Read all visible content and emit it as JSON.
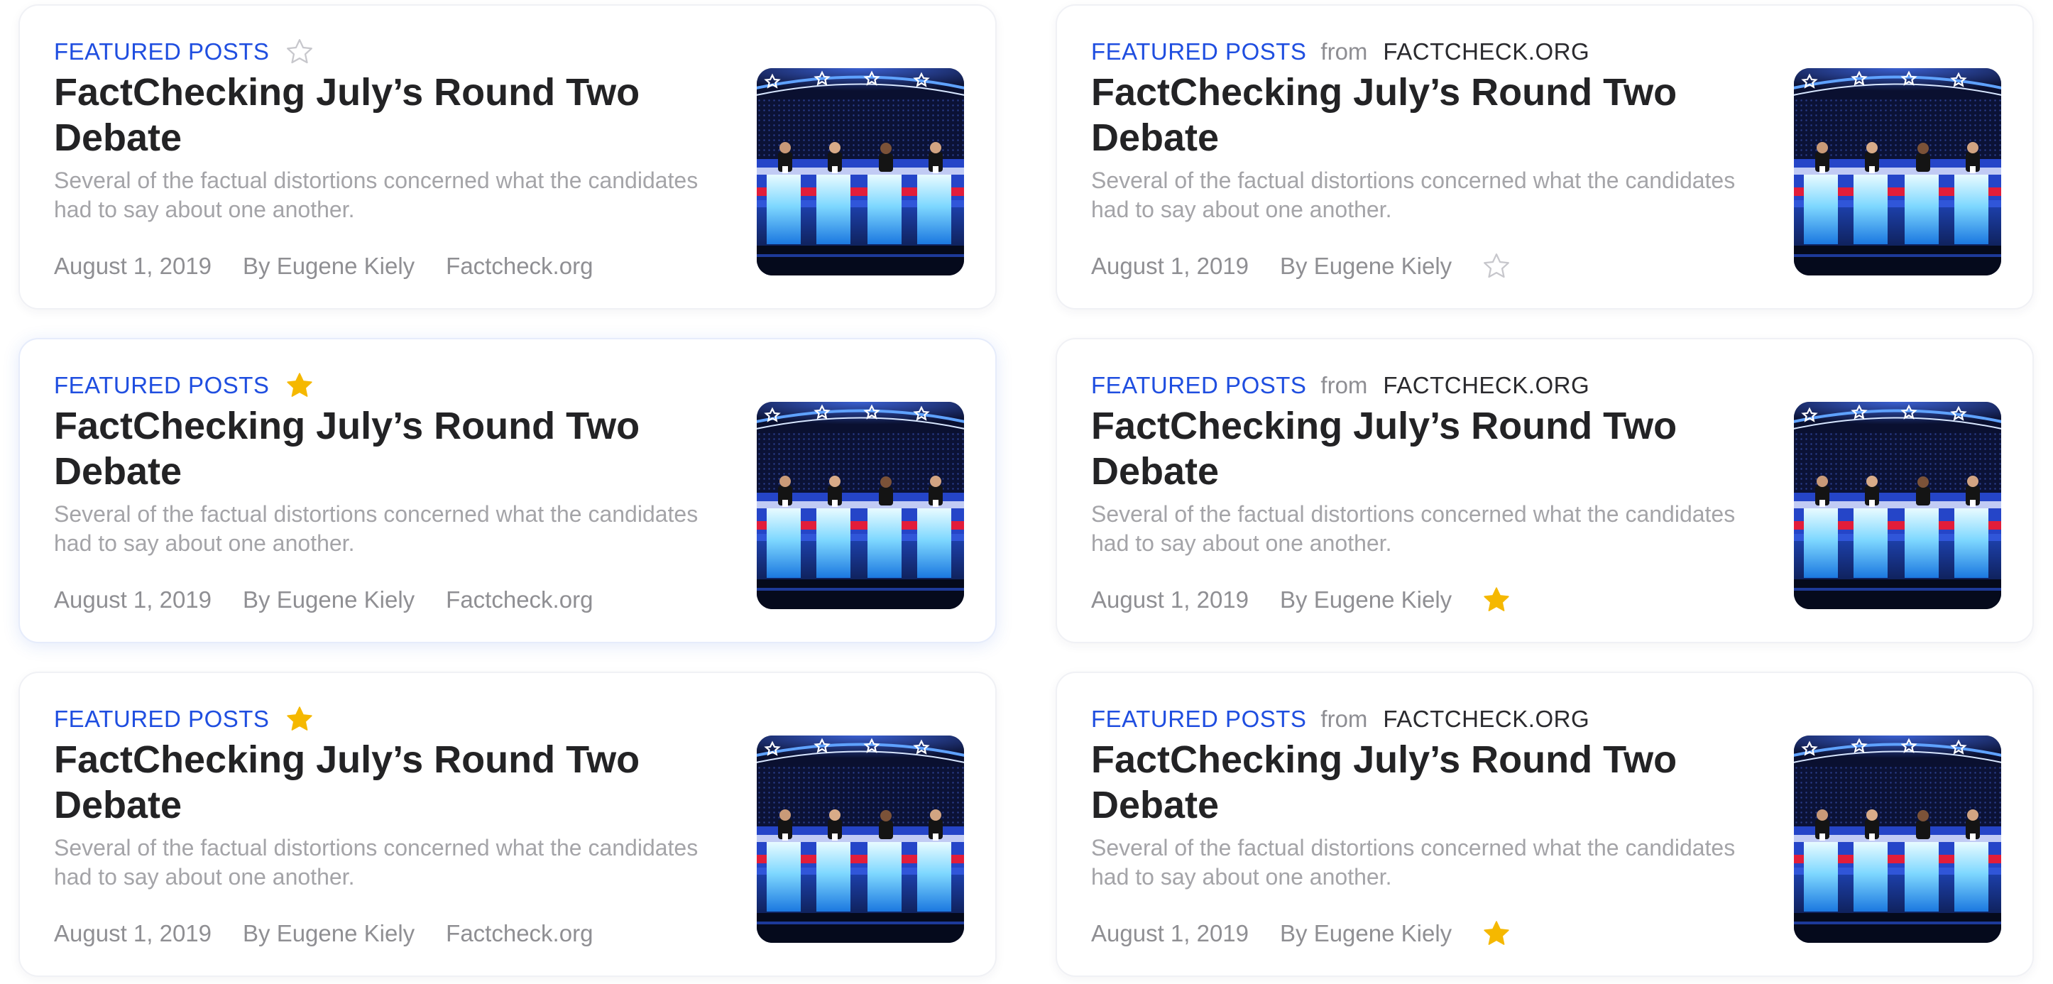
{
  "colors": {
    "accent": "#1f4ee0",
    "star_active": "#f5b800",
    "star_inactive": "#c7c7cc",
    "title": "#232325",
    "muted": "#8f8f93"
  },
  "cards": [
    {
      "kicker": "FEATURED POSTS",
      "title": "FactChecking July’s Round Two Debate",
      "excerpt": "Several of the factual distortions concerned what the candidates had to say about one another.",
      "date": "August 1, 2019",
      "author": "By Eugene Kiely",
      "source": "Factcheck.org",
      "starred": false,
      "icon": "star-outline-icon"
    },
    {
      "kicker": "FEATURED POSTS",
      "from_label": "from",
      "source_label": "FACTCHECK.ORG",
      "title": "FactChecking July’s Round Two Debate",
      "excerpt": "Several of the factual distortions concerned what the candidates had to say about one another.",
      "date": "August 1, 2019",
      "author": "By Eugene Kiely",
      "starred": false,
      "icon": "star-outline-icon"
    },
    {
      "kicker": "FEATURED POSTS",
      "title": "FactChecking July’s Round Two Debate",
      "excerpt": "Several of the factual distortions concerned what the candidates had to say about one another.",
      "date": "August 1, 2019",
      "author": "By Eugene Kiely",
      "source": "Factcheck.org",
      "starred": true,
      "icon": "star-filled-icon"
    },
    {
      "kicker": "FEATURED POSTS",
      "from_label": "from",
      "source_label": "FACTCHECK.ORG",
      "title": "FactChecking July’s Round Two Debate",
      "excerpt": "Several of the factual distortions concerned what the candidates had to say about one another.",
      "date": "August 1, 2019",
      "author": "By Eugene Kiely",
      "starred": true,
      "icon": "star-filled-icon"
    },
    {
      "kicker": "FEATURED POSTS",
      "title": "FactChecking July’s Round Two Debate",
      "excerpt": "Several of the factual distortions concerned what the candidates had to say about one another.",
      "date": "August 1, 2019",
      "author": "By Eugene Kiely",
      "source": "Factcheck.org",
      "starred": true,
      "icon": "star-filled-icon"
    },
    {
      "kicker": "FEATURED POSTS",
      "from_label": "from",
      "source_label": "FACTCHECK.ORG",
      "title": "FactChecking July’s Round Two Debate",
      "excerpt": "Several of the factual distortions concerned what the candidates had to say about one another.",
      "date": "August 1, 2019",
      "author": "By Eugene Kiely",
      "starred": true,
      "icon": "star-filled-icon"
    }
  ]
}
